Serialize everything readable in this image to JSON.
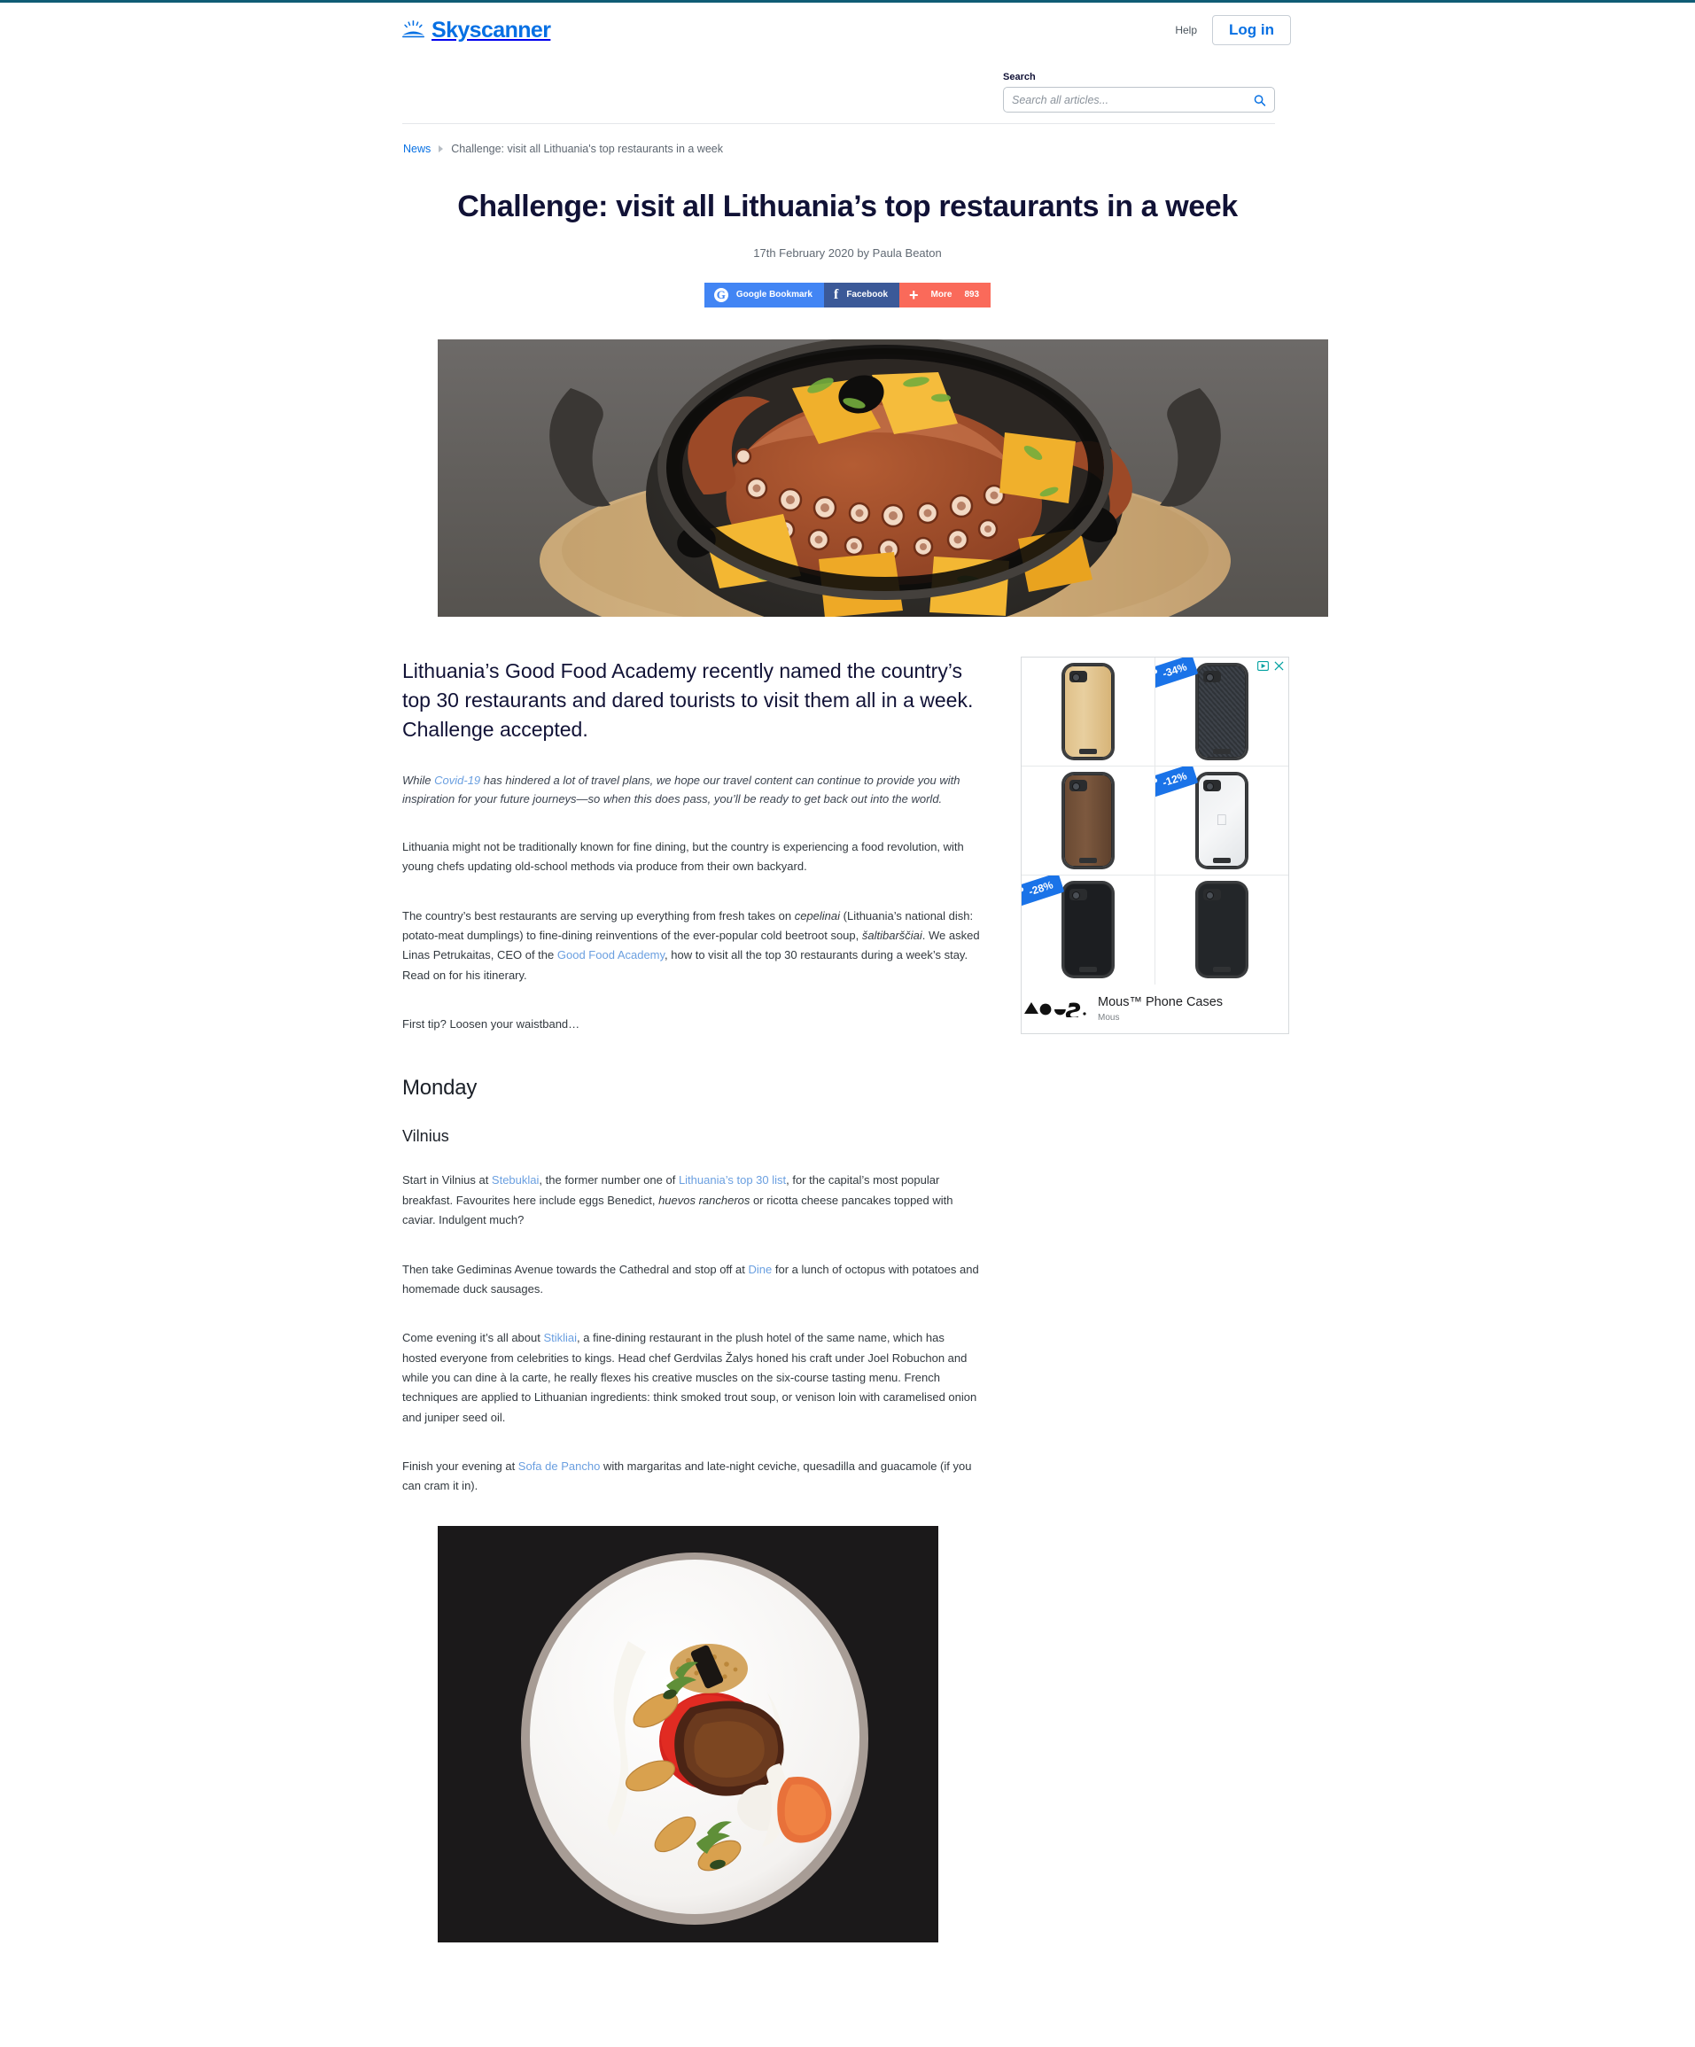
{
  "header": {
    "logo_text": "Skyscanner",
    "help_label": "Help",
    "login_label": "Log in"
  },
  "search": {
    "label": "Search",
    "placeholder": "Search all articles...",
    "value": ""
  },
  "breadcrumb": {
    "root": "News",
    "current": "Challenge: visit all Lithuania's top restaurants in a week"
  },
  "article": {
    "title": "Challenge: visit all Lithuania’s top restaurants in a week",
    "byline": "17th February 2020 by Paula Beaton",
    "lede": "Lithuania’s Good Food Academy recently named the country’s top 30 restaurants and dared tourists to visit them all in a week. Challenge accepted.",
    "note_pre": "While ",
    "note_link": "Covid-19",
    "note_post": " has hindered a lot of travel plans, we hope our travel content can continue to provide you with inspiration for your future journeys—so when this does pass, you’ll be ready to get back out into the world.",
    "para_1": "Lithuania might not be traditionally known for fine dining, but the country is experiencing a food revolution, with young chefs updating old-school methods via produce from their own backyard.",
    "para_2_a": "The country’s best restaurants are serving up everything from fresh takes on ",
    "para_2_i1": "cepelinai",
    "para_2_b": " (Lithuania’s national dish: potato-meat dumplings) to fine-dining reinventions of the ever-popular cold beetroot soup, ",
    "para_2_i2": "šaltibarščiai",
    "para_2_c": ". We asked Linas Petrukaitas, CEO of the ",
    "para_2_link": "Good Food Academy",
    "para_2_d": ", how to visit all the top 30 restaurants during a week’s stay. Read on for his itinerary.",
    "para_3": "First tip? Loosen your waistband…",
    "day_heading": "Monday",
    "city_heading": "Vilnius",
    "para_4_a": "Start in Vilnius at ",
    "para_4_link1": "Stebuklai",
    "para_4_b": ", the former number one of ",
    "para_4_link2": "Lithuania’s top 30 list",
    "para_4_c": ", for the capital’s most popular breakfast. Favourites here include eggs Benedict, ",
    "para_4_i1": "huevos rancheros",
    "para_4_d": " or ricotta cheese pancakes topped with caviar. Indulgent much?",
    "para_5_a": "Then take Gediminas Avenue towards the Cathedral and stop off at ",
    "para_5_link": "Dine",
    "para_5_b": " for a lunch of octopus with potatoes and homemade duck sausages.",
    "para_6_a": "Come evening it’s all about ",
    "para_6_link": "Stikliai",
    "para_6_b": ", a fine-dining restaurant in the plush hotel of the same name, which has hosted everyone from celebrities to kings. Head chef Gerdvilas Žalys honed his craft under Joel Robuchon and while you can dine à la carte, he really flexes his creative muscles on the six-course tasting menu. French techniques are applied to Lithuanian ingredients: think smoked trout soup, or venison loin with caramelised onion and juniper seed oil.",
    "para_7_a": "Finish your evening at ",
    "para_7_link": "Sofa de Pancho",
    "para_7_b": " with margaritas and late-night ceviche, quesadilla and guacamole (if you can cram it in)."
  },
  "share": {
    "google_label": "Google Bookmark",
    "facebook_label": "Facebook",
    "more_label": "More",
    "count": "893",
    "google_color": "#4285f4",
    "facebook_color": "#3b5998",
    "more_color": "#fa6a5a"
  },
  "ad": {
    "title": "Mous™ Phone Cases",
    "advertiser": "Mous",
    "items": [
      {
        "finish": "bamboo",
        "discount": ""
      },
      {
        "finish": "carbon",
        "discount": "-34%"
      },
      {
        "finish": "walnut",
        "discount": ""
      },
      {
        "finish": "clear",
        "discount": "-12%"
      },
      {
        "finish": "leather",
        "discount": "-28%"
      },
      {
        "finish": "black",
        "discount": ""
      }
    ]
  },
  "images": {
    "hero_alt": "Octopus with potatoes in a cast iron pan on a wooden board",
    "inline_alt": "Fine-dining plated dish with beef, red puree and croquettes on a white plate"
  },
  "colors": {
    "brand_blue": "#0770e3",
    "link_blue": "#6a9fe0",
    "text_dark": "#111236",
    "top_rule": "#0f5c75"
  }
}
